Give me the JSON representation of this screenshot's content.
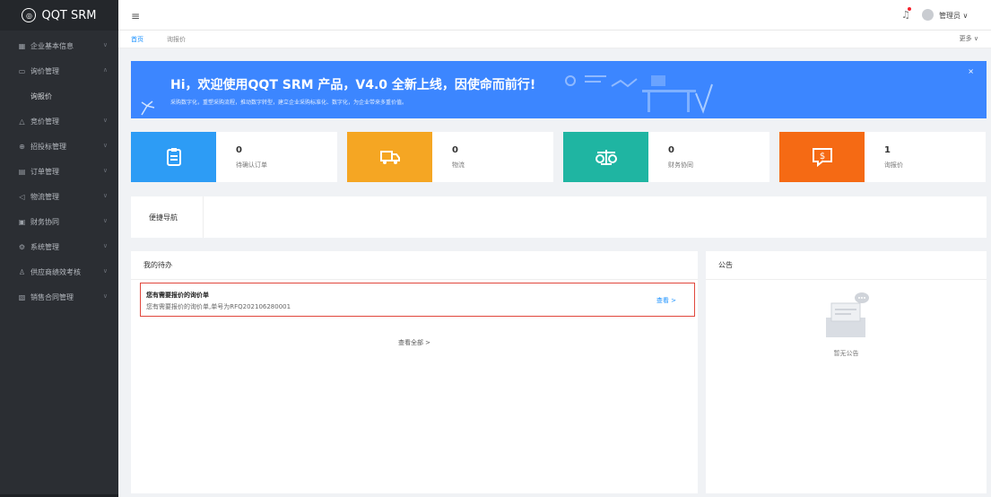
{
  "app": {
    "logo_text": "QQT SRM"
  },
  "sidebar": {
    "items": [
      {
        "label": "企业基本信息",
        "icon": "building-icon"
      },
      {
        "label": "询价管理",
        "icon": "inquiry-icon",
        "expanded": true
      },
      {
        "label": "询报价",
        "sub": true
      },
      {
        "label": "竞价管理",
        "icon": "bidding-icon"
      },
      {
        "label": "招投标管理",
        "icon": "tender-icon"
      },
      {
        "label": "订单管理",
        "icon": "order-icon"
      },
      {
        "label": "物流管理",
        "icon": "logistics-icon"
      },
      {
        "label": "财务协同",
        "icon": "finance-icon"
      },
      {
        "label": "系统管理",
        "icon": "gear-icon"
      },
      {
        "label": "供应商绩效考核",
        "icon": "person-icon"
      },
      {
        "label": "销售合同管理",
        "icon": "contract-icon"
      }
    ]
  },
  "topbar": {
    "user": "管理员 ∨"
  },
  "tabs": {
    "items": [
      "首页",
      "询报价"
    ],
    "more": "更多 ∨"
  },
  "banner": {
    "title": "Hi，欢迎使用QQT SRM 产品，V4.0 全新上线，因使命而前行!",
    "subtitle": "采购数字化，重塑采购流程，推动数字转型，建立企业采购标准化、数字化，为企业带来多重价值。",
    "close": "×",
    "color": "#3c86ff"
  },
  "stats": [
    {
      "value": "0",
      "label": "待确认订单",
      "color": "#2d9cf5",
      "icon": "clipboard-icon"
    },
    {
      "value": "0",
      "label": "物流",
      "color": "#f5a623",
      "icon": "truck-icon"
    },
    {
      "value": "0",
      "label": "财务协同",
      "color": "#1fb5a2",
      "icon": "scale-icon"
    },
    {
      "value": "1",
      "label": "询报价",
      "color": "#f56a14",
      "icon": "dollar-chat-icon"
    }
  ],
  "quicknav": {
    "title": "便捷导航"
  },
  "todo": {
    "title": "我的待办",
    "item_title": "您有需要报价的询价单",
    "item_desc": "您有需要报价的询价单,单号为RFQ202106280001",
    "view": "查看 >",
    "view_all": "查看全部 >"
  },
  "notice": {
    "title": "公告",
    "empty": "暂无公告"
  }
}
